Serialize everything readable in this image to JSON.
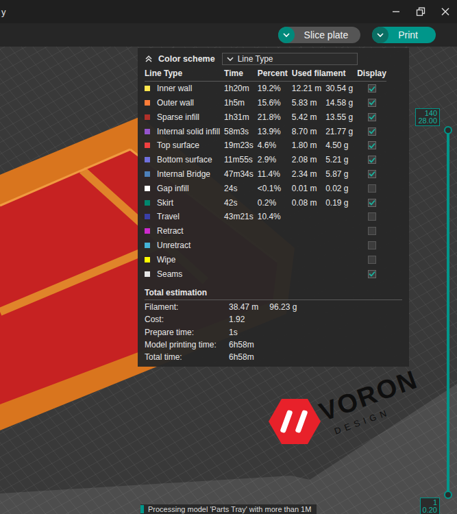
{
  "window": {
    "title": "y"
  },
  "toolbar": {
    "slice_button": "Slice plate",
    "print_button": "Print"
  },
  "legend": {
    "title": "Color scheme",
    "scheme": "Line Type",
    "columns": [
      "Line Type",
      "Time",
      "Percent",
      "Used filament",
      "Display"
    ],
    "rows": [
      {
        "name": "Inner wall",
        "time": "1h20m",
        "percent": "19.2%",
        "meters": "12.21 m",
        "grams": "30.54 g",
        "displayed": true,
        "color": "#ffe64d"
      },
      {
        "name": "Outer wall",
        "time": "1h5m",
        "percent": "15.6%",
        "meters": "5.83 m",
        "grams": "14.58 g",
        "displayed": true,
        "color": "#ff7d38"
      },
      {
        "name": "Sparse infill",
        "time": "1h31m",
        "percent": "21.8%",
        "meters": "5.42 m",
        "grams": "13.55 g",
        "displayed": true,
        "color": "#b03029"
      },
      {
        "name": "Internal solid infill",
        "time": "58m3s",
        "percent": "13.9%",
        "meters": "8.70 m",
        "grams": "21.77 g",
        "displayed": true,
        "color": "#9654cc"
      },
      {
        "name": "Top surface",
        "time": "19m23s",
        "percent": "4.6%",
        "meters": "1.80 m",
        "grams": "4.50 g",
        "displayed": true,
        "color": "#f04040"
      },
      {
        "name": "Bottom surface",
        "time": "11m55s",
        "percent": "2.9%",
        "meters": "2.08 m",
        "grams": "5.21 g",
        "displayed": true,
        "color": "#7070dd"
      },
      {
        "name": "Internal Bridge",
        "time": "47m34s",
        "percent": "11.4%",
        "meters": "2.34 m",
        "grams": "5.87 g",
        "displayed": true,
        "color": "#4d80ba"
      },
      {
        "name": "Gap infill",
        "time": "24s",
        "percent": "<0.1%",
        "meters": "0.01 m",
        "grams": "0.02 g",
        "displayed": false,
        "color": "#ffffff"
      },
      {
        "name": "Skirt",
        "time": "42s",
        "percent": "0.2%",
        "meters": "0.08 m",
        "grams": "0.19 g",
        "displayed": true,
        "color": "#00876e"
      },
      {
        "name": "Travel",
        "time": "43m21s",
        "percent": "10.4%",
        "displayed": false,
        "color": "#3a3fa8"
      },
      {
        "name": "Retract",
        "displayed": false,
        "color": "#cd2acd"
      },
      {
        "name": "Unretract",
        "displayed": false,
        "color": "#45b4d8"
      },
      {
        "name": "Wipe",
        "displayed": false,
        "color": "#ffff00"
      },
      {
        "name": "Seams",
        "displayed": true,
        "color": "#e6e6e6"
      }
    ],
    "totals": {
      "title": "Total estimation",
      "rows": [
        {
          "label": "Filament:",
          "values": [
            "38.47 m",
            "96.23 g"
          ]
        },
        {
          "label": "Cost:",
          "values": [
            "1.92"
          ]
        },
        {
          "label": "Prepare time:",
          "values": [
            "1s"
          ]
        },
        {
          "label": "Model printing time:",
          "values": [
            "6h58m"
          ]
        },
        {
          "label": "Total time:",
          "values": [
            "6h58m"
          ]
        }
      ]
    }
  },
  "layer_slider": {
    "thumbs": [
      {
        "layer": "140",
        "height": "28.00",
        "level": 1
      },
      {
        "layer": "1",
        "height": "0.20",
        "level": 0
      }
    ]
  },
  "bed": {
    "logo": "VORON",
    "logo_sub": "DESIGN"
  },
  "notification": {
    "text": "Processing model 'Parts Tray' with more than 1M"
  }
}
